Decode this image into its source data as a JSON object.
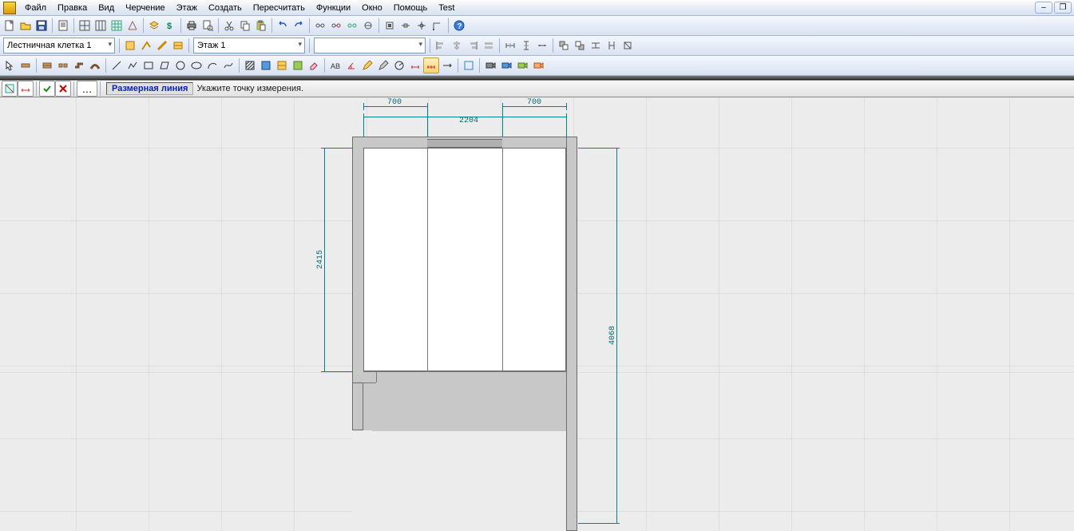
{
  "menu": {
    "items": [
      "Файл",
      "Правка",
      "Вид",
      "Черчение",
      "Этаж",
      "Создать",
      "Пересчитать",
      "Функции",
      "Окно",
      "Помощь",
      "Test"
    ]
  },
  "combos": {
    "layer": "Лестничная клетка 1",
    "floor": "Этаж 1",
    "empty": ""
  },
  "hint": {
    "mode": "Размерная линия",
    "text": "Укажите точку измерения."
  },
  "dims": {
    "top_left": "700",
    "top_right": "700",
    "top_span": "2204",
    "left_v": "2415",
    "right_v": "4068"
  },
  "icons": {
    "new": "new",
    "open": "open",
    "save": "save",
    "props": "props",
    "grid1": "grid",
    "grid2": "grid",
    "grid3": "grid",
    "grid4": "grid",
    "layers": "layers",
    "money": "money",
    "print": "print",
    "preview": "preview",
    "cut": "cut",
    "copy": "copy",
    "paste": "paste",
    "undo": "undo",
    "redo": "redo",
    "link1": "link",
    "link2": "link",
    "link3": "link",
    "link4": "link",
    "snap1": "snap",
    "snap2": "snap",
    "snap3": "snap",
    "snap4": "snap",
    "help": "help",
    "wall": "wall",
    "wall2": "wall",
    "wall3": "wall",
    "wall4": "wall",
    "wall5": "wall",
    "draw_line": "line",
    "draw_pline": "pline",
    "draw_rect": "rect",
    "draw_circle": "circle",
    "draw_arc": "arc",
    "hatch": "hatch",
    "fill": "fill",
    "erase": "erase",
    "text": "text",
    "angle": "angle",
    "dim": "dim",
    "dim2": "dim",
    "circle2": "circle",
    "mark1": "mark",
    "mark2": "mark",
    "mark3": "mark",
    "mark4": "mark",
    "cam1": "cam",
    "cam2": "cam",
    "cam3": "cam",
    "cam4": "cam",
    "align_l": "align",
    "align_c": "align",
    "align_r": "align",
    "align_j": "align",
    "dist1": "dist",
    "dist2": "dist",
    "dist3": "dist",
    "arr1": "arr",
    "arr2": "arr",
    "arr3": "arr",
    "arr4": "arr",
    "arr5": "arr"
  }
}
